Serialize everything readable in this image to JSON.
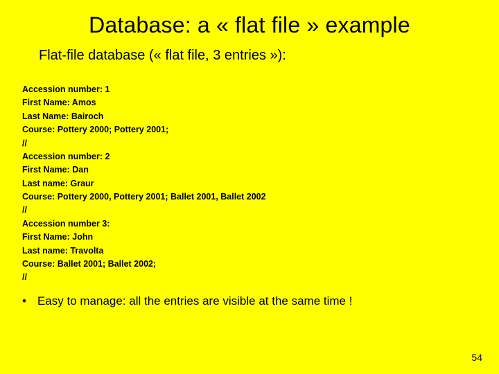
{
  "title": "Database: a « flat file » example",
  "subtitle": "Flat-file database (« flat file, 3 entries »):",
  "entries": [
    {
      "accession_label": "Accession number:",
      "accession_value": "1",
      "first_name_label": "First Name:",
      "first_name_value": "Amos",
      "last_name_label": "Last Name:",
      "last_name_value": "Bairoch",
      "course_label": "Course:",
      "course_value": "Pottery 2000; Pottery 2001;",
      "sep": "//"
    },
    {
      "accession_label": "Accession number:",
      "accession_value": "2",
      "first_name_label": "First Name:",
      "first_name_value": "Dan",
      "last_name_label": "Last name:",
      "last_name_value": "Graur",
      "course_label": "Course:",
      "course_value": "Pottery 2000, Pottery 2001; Ballet 2001, Ballet 2002",
      "sep": "//"
    },
    {
      "accession_label": "Accession number 3:",
      "accession_value": "",
      "first_name_label": "First Name:",
      "first_name_value": "John",
      "last_name_label": "Last name:",
      "last_name_value": "Travolta",
      "course_label": "Course:",
      "course_value": "Ballet 2001; Ballet 2002;",
      "sep": "//"
    }
  ],
  "bullet": {
    "marker": "•",
    "text": "Easy to manage: all the entries are visible at the same time !"
  },
  "page_number": "54"
}
